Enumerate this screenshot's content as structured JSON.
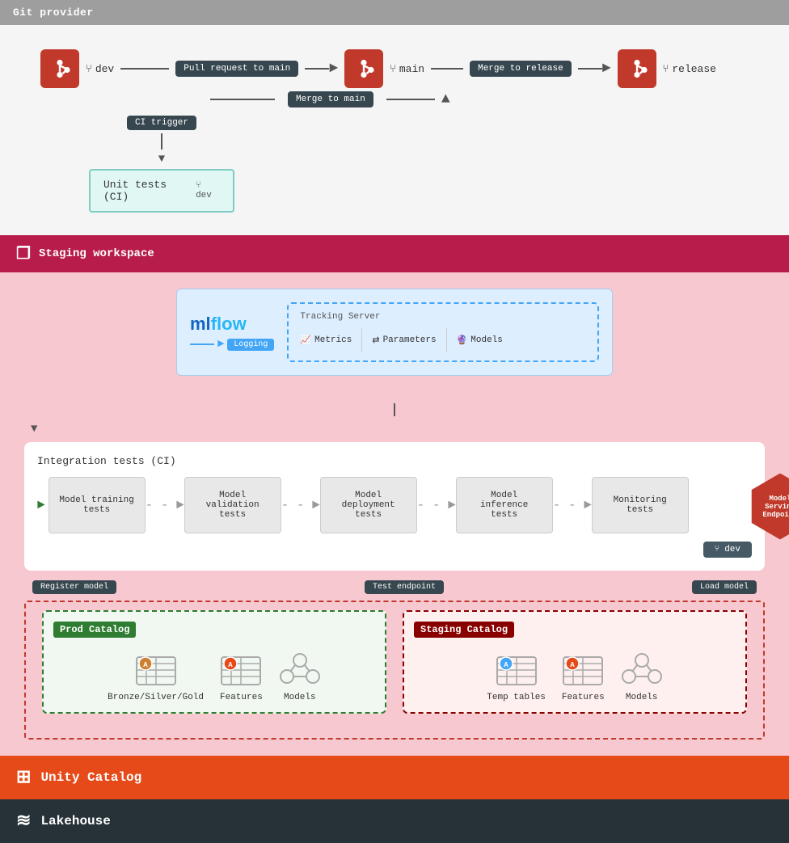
{
  "gitProvider": {
    "title": "Git provider"
  },
  "header": {
    "branches": {
      "dev": "dev",
      "main": "main",
      "release": "release"
    },
    "arrows": {
      "pullRequestToMain": "Pull request to main",
      "mergeToRelease": "Merge to release",
      "mergeToMain": "Merge to main",
      "ciTrigger": "CI trigger"
    }
  },
  "unitTests": {
    "label": "Unit tests (CI)",
    "branch": "dev"
  },
  "stagingWorkspace": {
    "title": "Staging workspace"
  },
  "trackingServer": {
    "title": "Tracking Server",
    "metrics": "Metrics",
    "parameters": "Parameters",
    "models": "Models",
    "logging": "Logging"
  },
  "integrationTests": {
    "title": "Integration tests (CI)",
    "steps": [
      "Model training tests",
      "Model validation tests",
      "Model deployment tests",
      "Model inference tests",
      "Monitoring tests"
    ],
    "devBranch": "dev"
  },
  "modelServingEndpoint": {
    "label": "Model Serving Endpoint"
  },
  "labels": {
    "registerModel": "Register model",
    "testEndpoint": "Test endpoint",
    "loadModel": "Load model"
  },
  "prodCatalog": {
    "title": "Prod Catalog",
    "items": [
      "Bronze/Silver/Gold",
      "Features",
      "Models"
    ]
  },
  "stagingCatalog": {
    "title": "Staging Catalog",
    "items": [
      "Temp tables",
      "Features",
      "Models"
    ]
  },
  "unityCatalog": {
    "title": "Unity Catalog"
  },
  "lakehouse": {
    "title": "Lakehouse"
  }
}
